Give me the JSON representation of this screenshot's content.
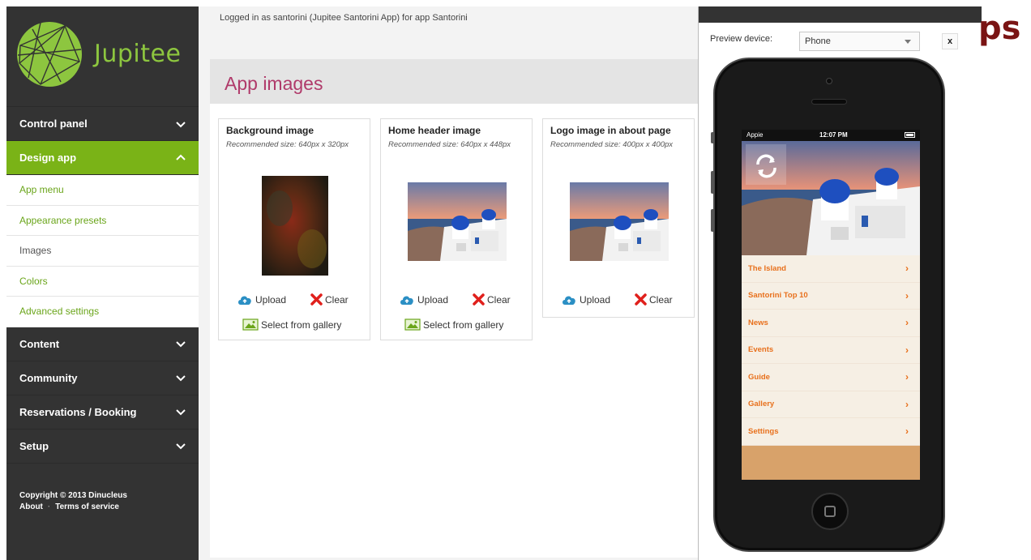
{
  "brand": {
    "name": "Jupitee",
    "color": "#8dc63f"
  },
  "sidebar": {
    "items": [
      {
        "label": "Control panel",
        "icon": "chevron-down-icon"
      },
      {
        "label": "Design app",
        "icon": "chevron-up-icon",
        "active": true
      }
    ],
    "submenu": [
      {
        "label": "App menu"
      },
      {
        "label": "Appearance presets"
      },
      {
        "label": "Images"
      },
      {
        "label": "Colors"
      },
      {
        "label": "Advanced settings"
      }
    ],
    "items_after": [
      {
        "label": "Content",
        "icon": "chevron-down-icon"
      },
      {
        "label": "Community",
        "icon": "chevron-down-icon"
      },
      {
        "label": "Reservations / Booking",
        "icon": "chevron-down-icon"
      },
      {
        "label": "Setup",
        "icon": "chevron-down-icon"
      }
    ],
    "copyright": "Copyright © 2013 Dinucleus",
    "links": {
      "about": "About",
      "separator": "·",
      "terms": "Terms of service"
    }
  },
  "main": {
    "login_info": "Logged in as santorini (Jupitee Santorini App) for app Santorini",
    "title": "App images",
    "cards": [
      {
        "title": "Background image",
        "recommended": "Recommended size: 640px x 320px",
        "upload": "Upload",
        "clear": "Clear",
        "gallery": "Select from gallery"
      },
      {
        "title": "Home header image",
        "recommended": "Recommended size: 640px x 448px",
        "upload": "Upload",
        "clear": "Clear",
        "gallery": "Select from gallery"
      },
      {
        "title": "Logo image in about page",
        "recommended": "Recommended size: 400px x 400px",
        "upload": "Upload",
        "clear": "Clear"
      }
    ]
  },
  "preview": {
    "label": "Preview device:",
    "device": "Phone",
    "close": "x",
    "status": {
      "carrier": "Appie",
      "time": "12:07 PM"
    },
    "menu": [
      "The Island",
      "Santorini Top 10",
      "News",
      "Events",
      "Guide",
      "Gallery",
      "Settings"
    ]
  },
  "corner_text": "ps",
  "colors": {
    "accent_green": "#7ab317",
    "title_magenta": "#b03a6a",
    "menu_orange": "#e8701c",
    "sidebar_bg": "#333333"
  }
}
